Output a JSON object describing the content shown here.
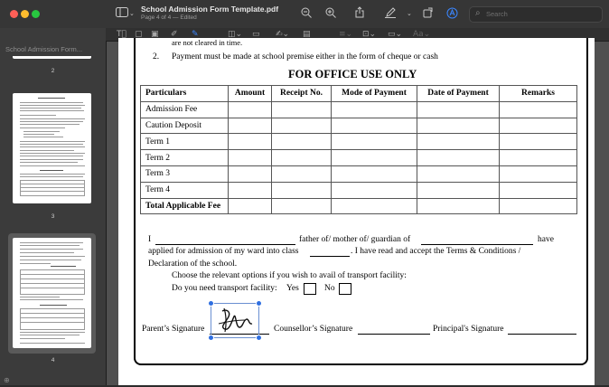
{
  "window": {
    "title": "School Admission Form Template.pdf",
    "subtitle": "Page 4 of 4 — Edited"
  },
  "toolbar": {
    "icons": [
      "sidebar-toggle-icon",
      "chevron-down-icon",
      "zoom-out-icon",
      "zoom-in-icon",
      "share-icon",
      "markup-pen-icon",
      "chevron-down-icon",
      "rotate-icon",
      "markup-toolbar-icon"
    ],
    "search_placeholder": "Search"
  },
  "markup_toolbar": {
    "icons": [
      "text-selection-icon",
      "rectangle-selection-icon",
      "redact-icon",
      "sketch-icon",
      "draw-icon",
      "shapes-icon",
      "text-box-icon",
      "sign-icon",
      "note-icon",
      "shape-style-icon",
      "border-color-icon",
      "fill-color-icon",
      "text-style-icon"
    ]
  },
  "sidebar": {
    "top_label": "School Admission Form...",
    "pages": [
      {
        "number": "2"
      },
      {
        "number": "3"
      },
      {
        "number": "4"
      }
    ]
  },
  "document": {
    "cut_line": "are not cleared in time.",
    "item2_num": "2.",
    "item2_text": "Payment must be made at school premise either in the form of cheque or cash",
    "office_heading": "FOR OFFICE USE ONLY",
    "table": {
      "headers": [
        "Particulars",
        "Amount",
        "Receipt No.",
        "Mode of Payment",
        "Date of Payment",
        "Remarks"
      ],
      "rows": [
        "Admission Fee",
        "Caution Deposit",
        "Term 1",
        "Term 2",
        "Term 3",
        "Term 4",
        "Total Applicable Fee"
      ]
    },
    "decl_I": "I",
    "decl_part1": "father of/ mother of/ guardian of",
    "decl_have": "have",
    "decl_line2a": "applied for admission of my ward into class",
    "decl_line2b": ".  I have read and accept the Terms & Conditions /",
    "decl_line3": "Declaration of the school.",
    "transport_line": "Choose the relevant options if you wish to avail of transport facility:",
    "transport_q": "Do you need transport facility:",
    "yes": "Yes",
    "no": "No",
    "parent_sig": "Parent’s Signature",
    "counsellor_sig": "Counsellor’s Signature",
    "principal_sig": "Principal's Signature"
  }
}
